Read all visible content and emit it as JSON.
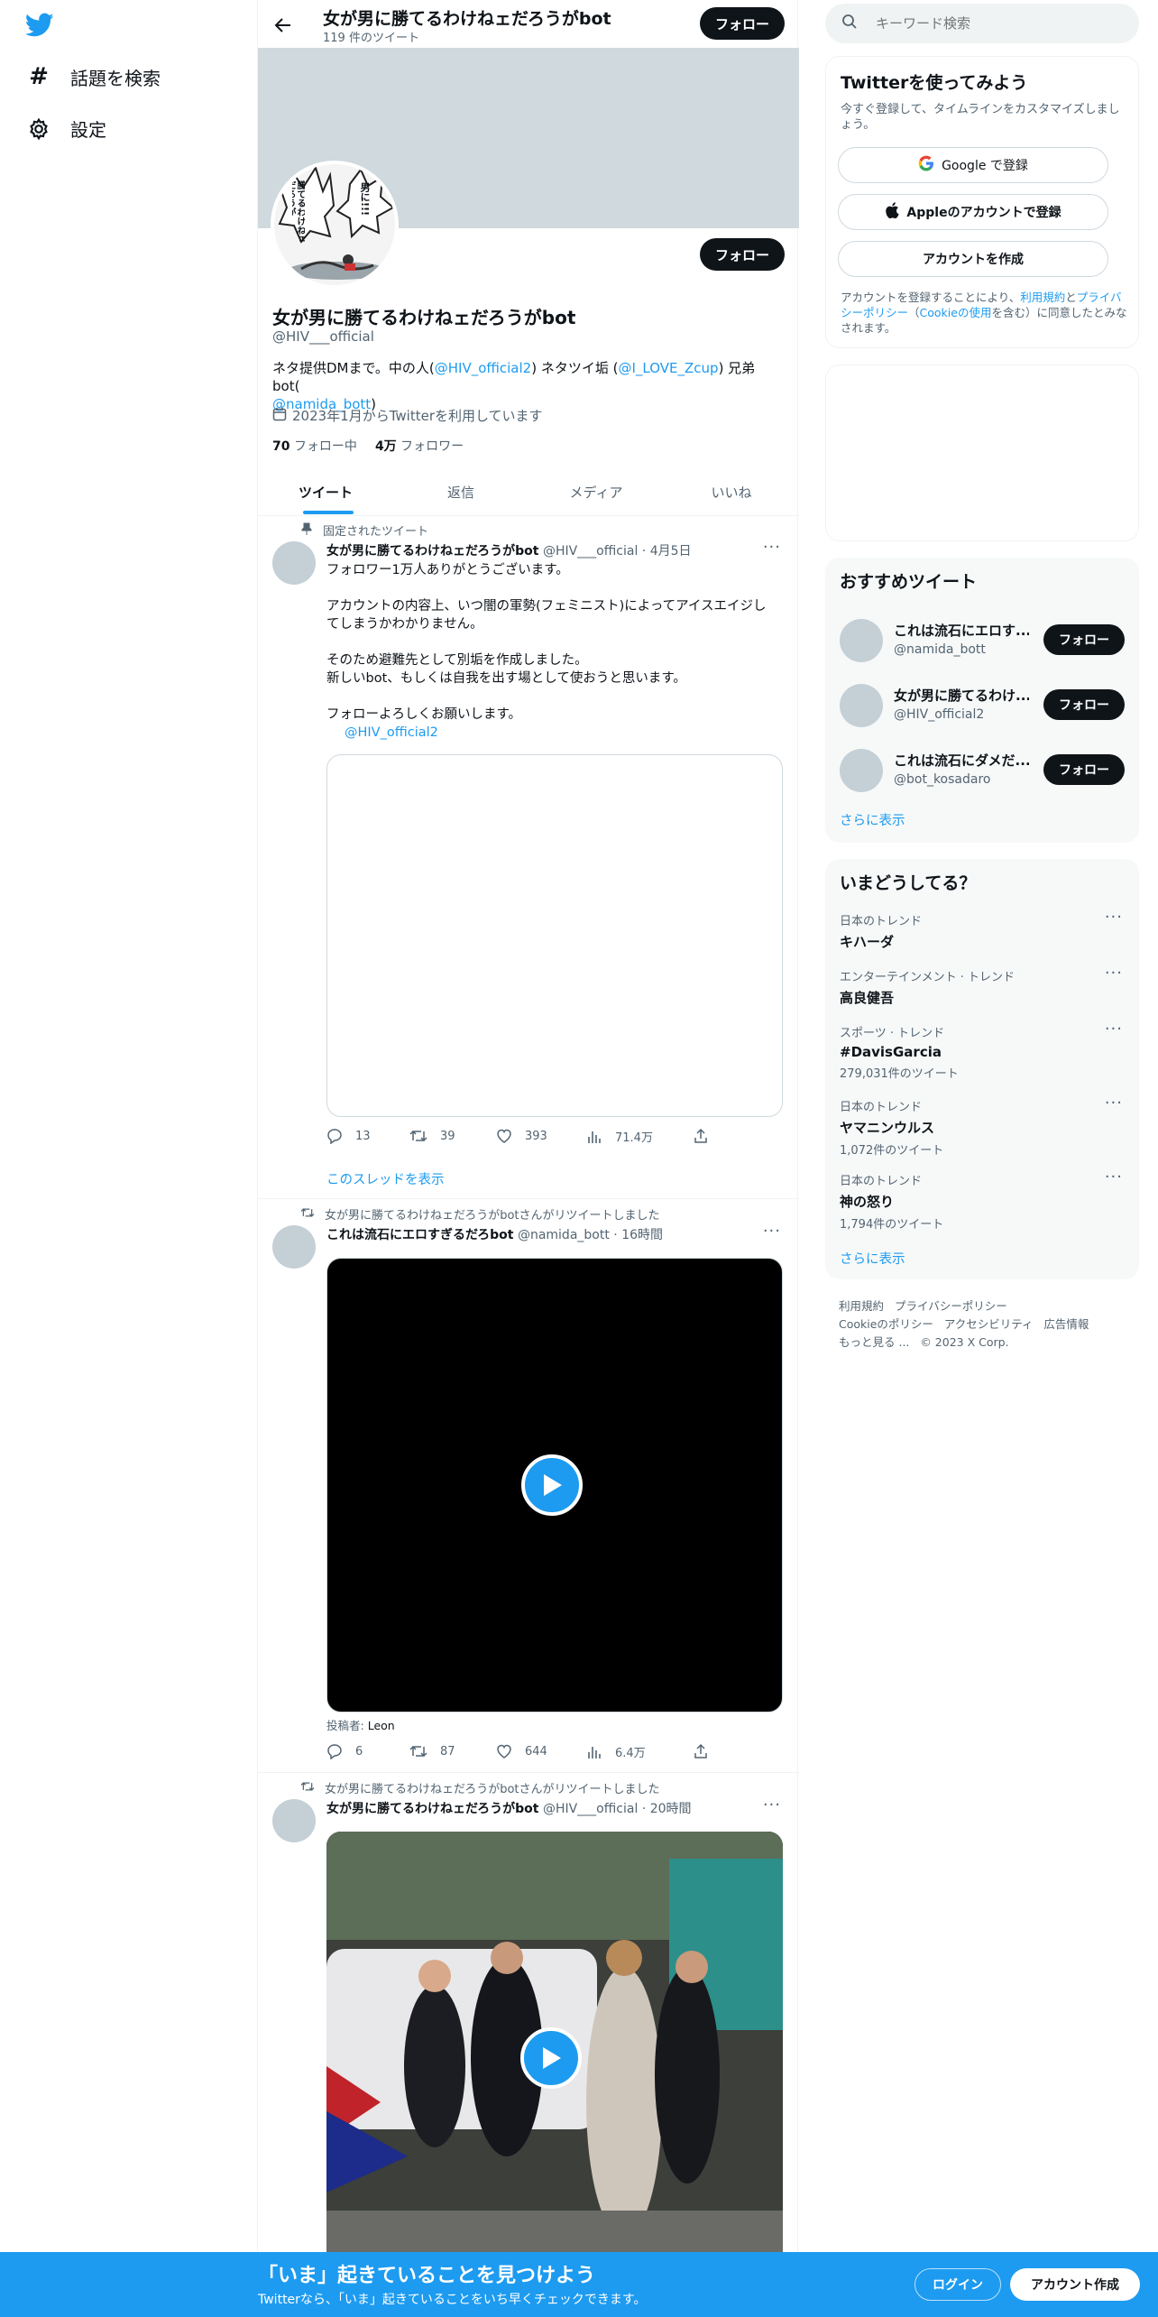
{
  "nav": {
    "explore_label": "話題を検索",
    "settings_label": "設定"
  },
  "header": {
    "title": "女が男に勝てるわけねェだろうがbot",
    "tweet_count": "119 件のツイート",
    "follow_label": "フォロー"
  },
  "profile": {
    "name": "女が男に勝てるわけねェだろうがbot",
    "handle": "@HIV___official",
    "follow_label": "フォロー",
    "bio_text1": "ネタ提供DMまで。中の人(",
    "bio_link1": "@HIV_official2",
    "bio_text2": ") ネタツイ垢 (",
    "bio_link2": "@I_LOVE_Zcup",
    "bio_text3": ") 兄弟bot(",
    "bio_link3": "@namida_bott",
    "bio_text4": ")",
    "joined": "2023年1月からTwitterを利用しています",
    "following_count": "70",
    "following_label": "フォロー中",
    "followers_count": "4万",
    "followers_label": "フォロワー",
    "avatar_text_left": "勝てるわけねェだろうが",
    "avatar_text_right": "男に!!!"
  },
  "tabs": [
    "ツイート",
    "返信",
    "メディア",
    "いいね"
  ],
  "tweets": [
    {
      "context": "固定されたツイート",
      "name": "女が男に勝てるわけねェだろうがbot",
      "handle": "@HIV___official",
      "time": "· 4月5日",
      "lines": [
        "フォロワー1万人ありがとうございます。",
        "アカウントの内容上、いつ闇の軍勢(フェミニスト)によってアイスエイジし",
        "てしまうかわかりません。",
        "そのため避難先として別垢を作成しました。",
        "新しいbot、もしくは自我を出す場として使おうと思います。",
        "フォローよろしくお願いします。"
      ],
      "mention": "@HIV_official2",
      "replies": "13",
      "retweets": "39",
      "likes": "393",
      "views": "71.4万",
      "thread_link": "このスレッドを表示"
    },
    {
      "context": "女が男に勝てるわけねェだろうがbotさんがリツイートしました",
      "name": "これは流石にエロすぎるだろbot",
      "handle": "@namida_bott",
      "time": "· 16時間",
      "poster_label": "投稿者:",
      "poster_name": "Leon",
      "replies": "6",
      "retweets": "87",
      "likes": "644",
      "views": "6.4万"
    },
    {
      "context": "女が男に勝てるわけねェだろうがbotさんがリツイートしました",
      "name": "女が男に勝てるわけねェだろうがbot",
      "handle": "@HIV___official",
      "time": "· 20時間"
    }
  ],
  "search": {
    "placeholder": "キーワード検索"
  },
  "signup": {
    "title": "Twitterを使ってみよう",
    "subtitle": "今すぐ登録して、タイムラインをカスタマイズしましょう。",
    "google_label": "Google で登録",
    "apple_label": "Appleのアカウントで登録",
    "create_label": "アカウントを作成",
    "terms_pre": "アカウントを登録することにより、",
    "terms_link": "利用規約",
    "terms_and": "と",
    "privacy_link": "プライバシーポリシー",
    "terms_mid": "（",
    "cookie_link": "Cookieの使用",
    "terms_post": "を含む）に同意したとみなされます。"
  },
  "recommend": {
    "title": "おすすめツイート",
    "follow_label": "フォロー",
    "accounts": [
      {
        "name": "これは流石にエロす...",
        "handle": "@namida_bott"
      },
      {
        "name": "女が男に勝てるわけ...",
        "handle": "@HIV_official2"
      },
      {
        "name": "これは流石にダメだ...",
        "handle": "@bot_kosadaro"
      }
    ],
    "more": "さらに表示"
  },
  "trends": {
    "title": "いまどうしてる？",
    "items": [
      {
        "category": "日本のトレンド",
        "name": "キハーダ",
        "count": ""
      },
      {
        "category": "エンターテインメント · トレンド",
        "name": "高良健吾",
        "count": ""
      },
      {
        "category": "スポーツ · トレンド",
        "name": "#DavisGarcia",
        "count": "279,031件のツイート"
      },
      {
        "category": "日本のトレンド",
        "name": "ヤマニンウルス",
        "count": "1,072件のツイート"
      },
      {
        "category": "日本のトレンド",
        "name": "神の怒り",
        "count": "1,794件のツイート"
      }
    ],
    "more": "さらに表示"
  },
  "footer": {
    "terms": "利用規約",
    "privacy": "プライバシーポリシー",
    "cookie": "Cookieのポリシー",
    "accessibility": "アクセシビリティ",
    "ads": "広告情報",
    "more": "もっと見る ...",
    "copyright": "© 2023 X Corp."
  },
  "bottom_bar": {
    "title": "「いま」起きていることを見つけよう",
    "subtitle": "Twitterなら、「いま」起きていることをいち早くチェックできます。",
    "login_label": "ログイン",
    "signup_label": "アカウント作成"
  },
  "colors": {
    "accent": "#1d9bf0",
    "dark": "#0f1419",
    "muted": "#536471",
    "banner": "#cfd9de"
  }
}
